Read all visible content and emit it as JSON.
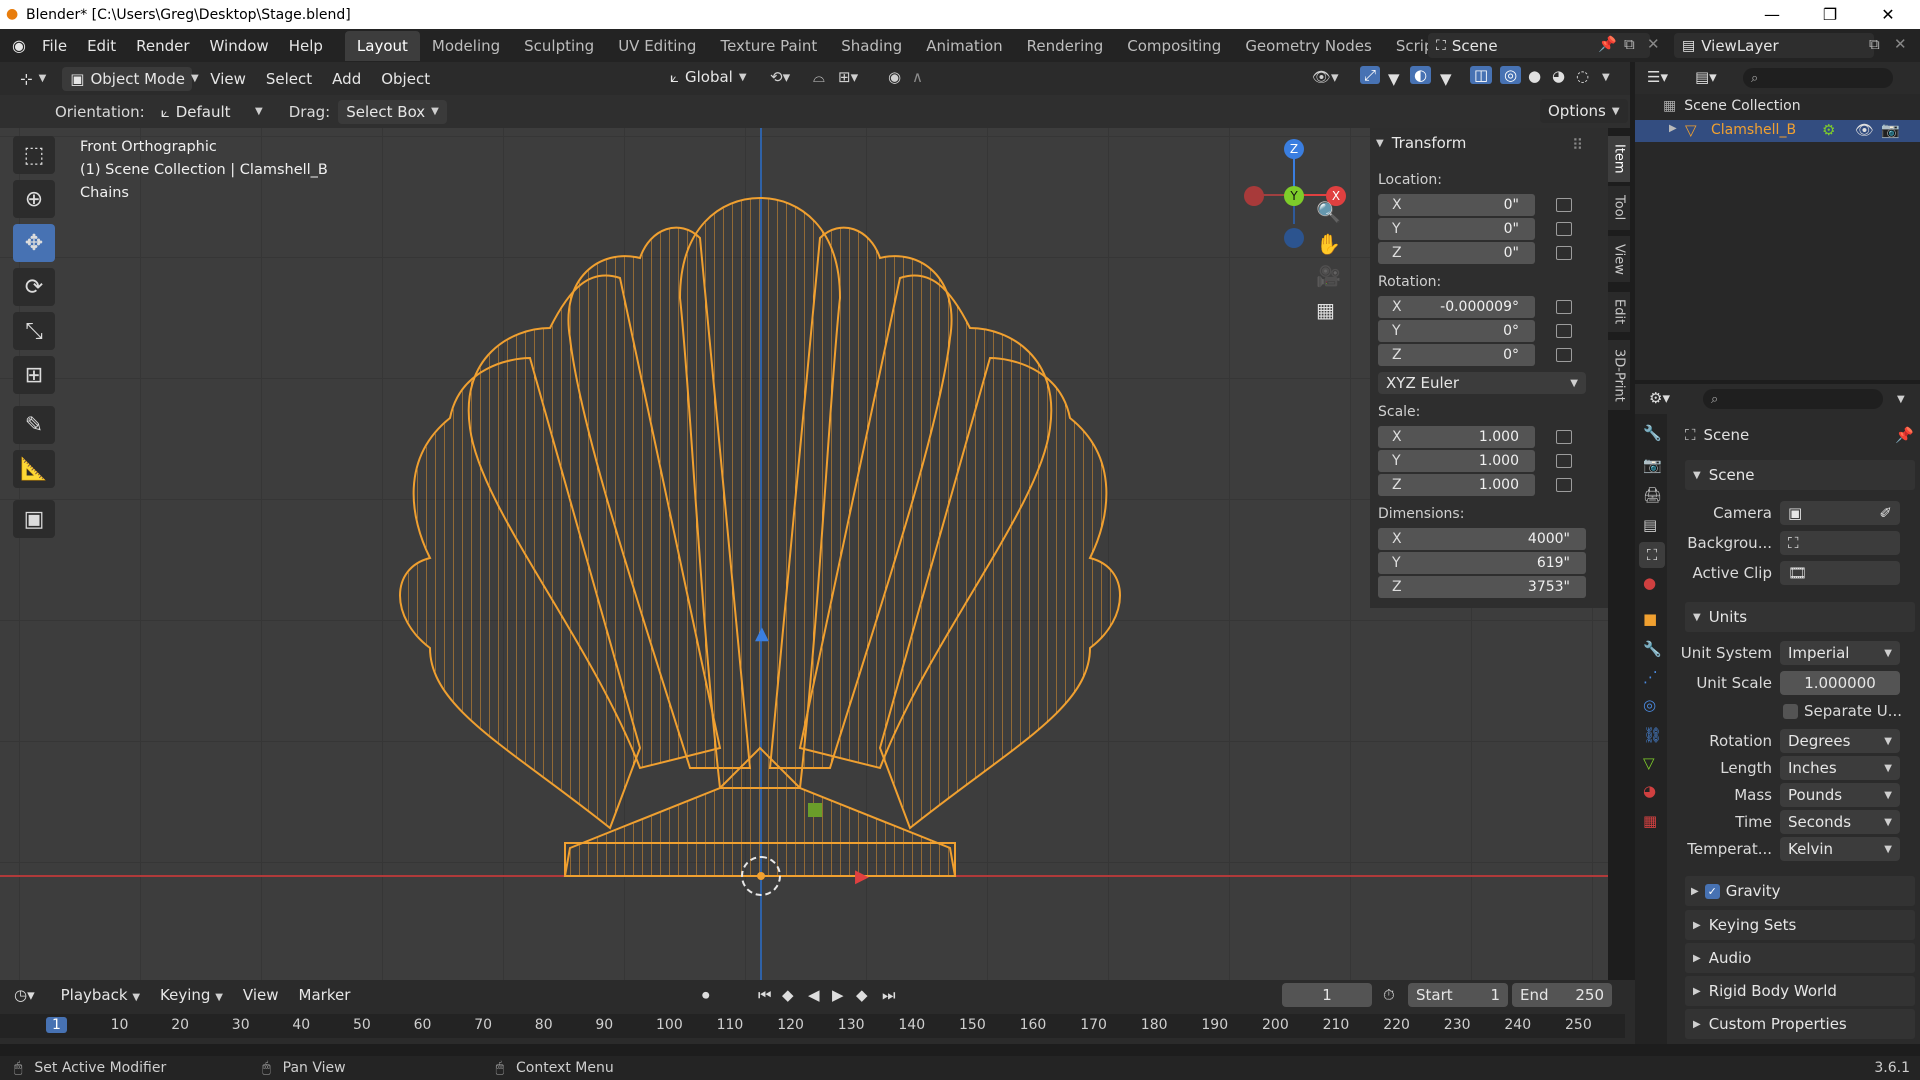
{
  "window": {
    "title": "Blender* [C:\\Users\\Greg\\Desktop\\Stage.blend]",
    "controls": [
      "—",
      "❐",
      "✕"
    ]
  },
  "menu": [
    "File",
    "Edit",
    "Render",
    "Window",
    "Help"
  ],
  "workspaces": [
    "Layout",
    "Modeling",
    "Sculpting",
    "UV Editing",
    "Texture Paint",
    "Shading",
    "Animation",
    "Rendering",
    "Compositing",
    "Geometry Nodes",
    "Scripting",
    "+"
  ],
  "active_workspace": "Layout",
  "scene_name": "Scene",
  "view_layer": "ViewLayer",
  "viewport_header": {
    "mode": "Object Mode",
    "menus": [
      "View",
      "Select",
      "Add",
      "Object"
    ],
    "transform_orientation": "Global",
    "orientation_label": "Orientation:",
    "orientation_value": "Default",
    "drag_label": "Drag:",
    "drag_value": "Select Box",
    "options": "Options"
  },
  "viewport_overlay": {
    "view_name": "Front Orthographic",
    "collection": "(1) Scene Collection | Clamshell_B",
    "object_info": "Chains"
  },
  "gizmo": {
    "z": "Z",
    "y": "Y",
    "x": "X"
  },
  "n_panel": {
    "header": "Transform",
    "location_label": "Location:",
    "location": [
      {
        "axis": "X",
        "value": "0\""
      },
      {
        "axis": "Y",
        "value": "0\""
      },
      {
        "axis": "Z",
        "value": "0\""
      }
    ],
    "rotation_label": "Rotation:",
    "rotation": [
      {
        "axis": "X",
        "value": "-0.000009°"
      },
      {
        "axis": "Y",
        "value": "0°"
      },
      {
        "axis": "Z",
        "value": "0°"
      }
    ],
    "rotation_mode": "XYZ Euler",
    "scale_label": "Scale:",
    "scale": [
      {
        "axis": "X",
        "value": "1.000"
      },
      {
        "axis": "Y",
        "value": "1.000"
      },
      {
        "axis": "Z",
        "value": "1.000"
      }
    ],
    "dimensions_label": "Dimensions:",
    "dimensions": [
      {
        "axis": "X",
        "value": "4000\""
      },
      {
        "axis": "Y",
        "value": "619\""
      },
      {
        "axis": "Z",
        "value": "3753\""
      }
    ]
  },
  "side_tabs": [
    "Item",
    "Tool",
    "View",
    "Edit",
    "3D-Print"
  ],
  "outliner": {
    "root": "Scene Collection",
    "item": "Clamshell_B"
  },
  "properties": {
    "scene_title": "Scene",
    "scene_panel": "Scene",
    "camera_label": "Camera",
    "background_label": "Backgrou...",
    "active_clip_label": "Active Clip",
    "units_panel": "Units",
    "unit_system_label": "Unit System",
    "unit_system": "Imperial",
    "unit_scale_label": "Unit Scale",
    "unit_scale": "1.000000",
    "separate_units": "Separate U...",
    "rotation_label": "Rotation",
    "rotation": "Degrees",
    "length_label": "Length",
    "length": "Inches",
    "mass_label": "Mass",
    "mass": "Pounds",
    "time_label": "Time",
    "time": "Seconds",
    "temperature_label": "Temperat...",
    "temperature": "Kelvin",
    "gravity": "Gravity",
    "keying_sets": "Keying Sets",
    "audio": "Audio",
    "rigid_body": "Rigid Body World",
    "custom_props": "Custom Properties"
  },
  "timeline": {
    "menus": [
      "Playback",
      "Keying",
      "View",
      "Marker"
    ],
    "current_frame": "1",
    "start_label": "Start",
    "start": "1",
    "end_label": "End",
    "end": "250",
    "ruler": [
      "1",
      "10",
      "20",
      "30",
      "40",
      "50",
      "60",
      "70",
      "80",
      "90",
      "100",
      "110",
      "120",
      "130",
      "140",
      "150",
      "160",
      "170",
      "180",
      "190",
      "200",
      "210",
      "220",
      "230",
      "240",
      "250"
    ]
  },
  "status": {
    "left": "Set Active Modifier",
    "mid": "Pan View",
    "right": "Context Menu",
    "version": "3.6.1"
  },
  "colors": {
    "accent": "#4772b3",
    "wire": "#f0a030",
    "x_axis": "#e04040",
    "y_axis": "#7ecc2a",
    "z_axis": "#3a7ee0"
  }
}
